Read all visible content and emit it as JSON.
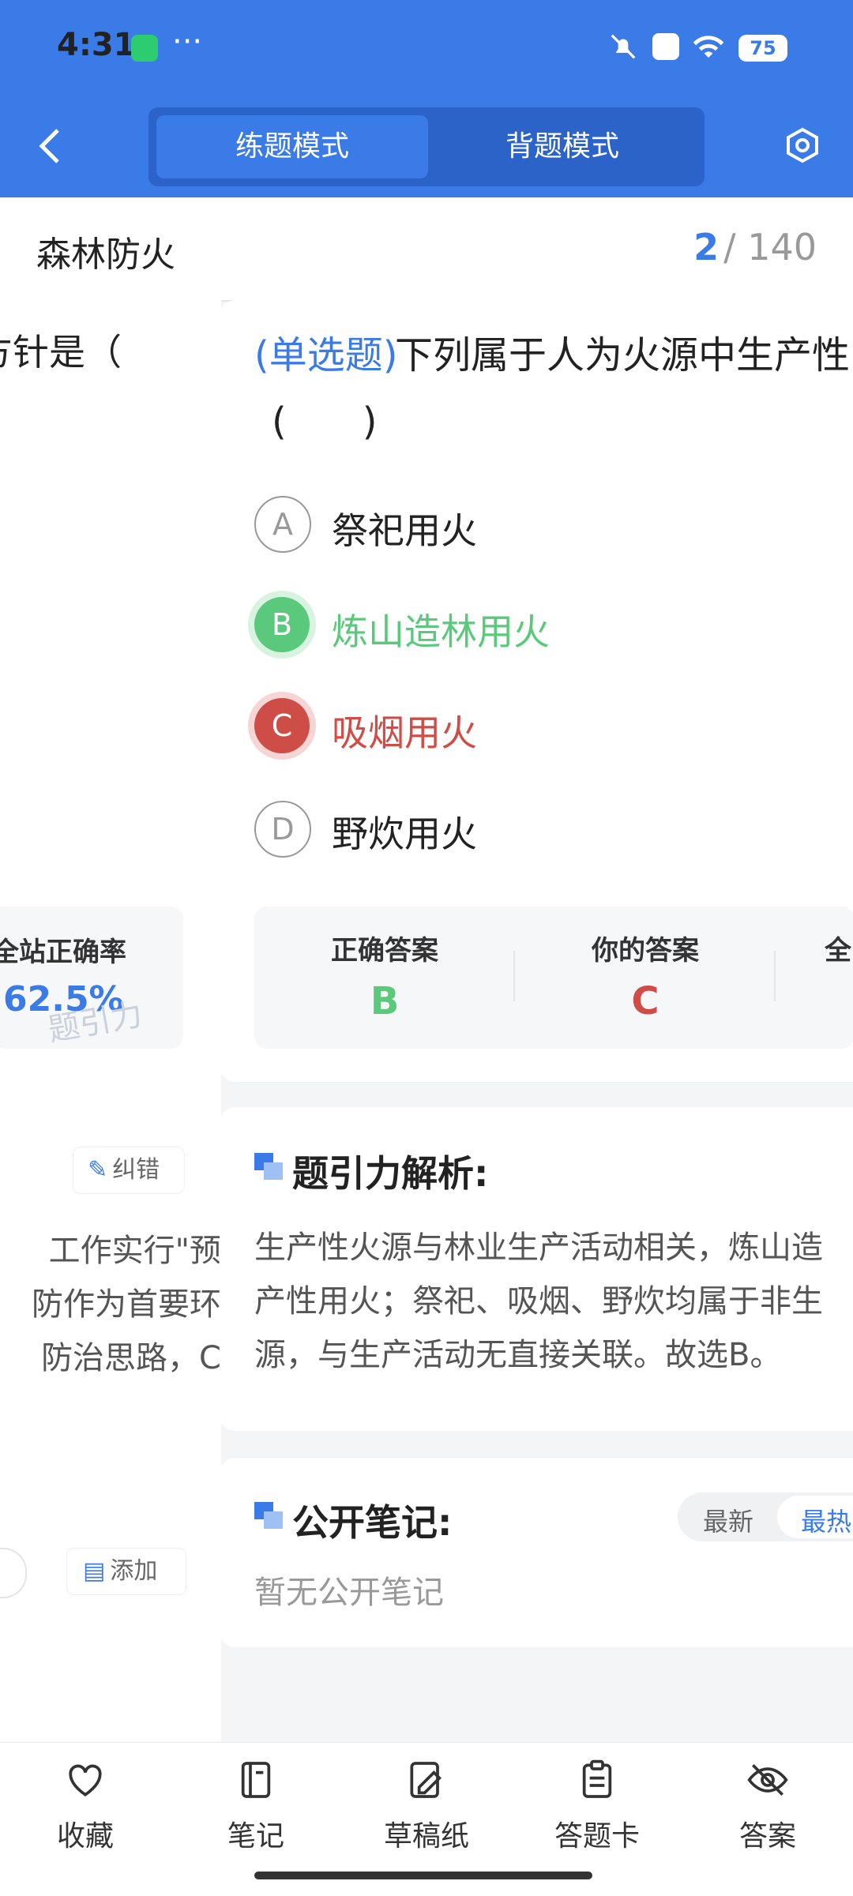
{
  "status_bar": {
    "time": "4:31",
    "more": "···",
    "battery": "75"
  },
  "header": {
    "tabs": [
      "练题模式",
      "背题模式"
    ],
    "active_tab": 0
  },
  "section": {
    "title": "森林防火",
    "current": "2",
    "total": "/ 140"
  },
  "left_preview": {
    "question_fragment": "方针是（",
    "stat_label": "全站正确率",
    "stat_value": "62.5%",
    "watermark": "题引力",
    "correct_button": "纠错",
    "analysis_lines": [
      "工作实行\"预",
      "防作为首要环",
      "防治思路，C"
    ],
    "add_button": "添加"
  },
  "question": {
    "type": "(单选题)",
    "text": "下列属于人为火源中生产性",
    "blank": "(　　)",
    "options": [
      {
        "letter": "A",
        "text": "祭祀用火",
        "state": "plain"
      },
      {
        "letter": "B",
        "text": "炼山造林用火",
        "state": "right"
      },
      {
        "letter": "C",
        "text": "吸烟用火",
        "state": "wrong"
      },
      {
        "letter": "D",
        "text": "野炊用火",
        "state": "plain"
      }
    ]
  },
  "answer": {
    "correct_label": "正确答案",
    "correct_value": "B",
    "yours_label": "你的答案",
    "yours_value": "C",
    "third_label": "全"
  },
  "analysis": {
    "heading": "题引力解析:",
    "lines": [
      "生产性火源与林业生产活动相关，炼山造",
      "产性用火；祭祀、吸烟、野炊均属于非生",
      "源，与生产活动无直接关联。故选B。"
    ]
  },
  "notes": {
    "heading": "公开笔记:",
    "sort_new": "最新",
    "sort_hot": "最热",
    "empty": "暂无公开笔记"
  },
  "bottom_nav": [
    {
      "label": "收藏",
      "icon": "heart-icon"
    },
    {
      "label": "笔记",
      "icon": "notebook-icon"
    },
    {
      "label": "草稿纸",
      "icon": "draft-icon"
    },
    {
      "label": "答题卡",
      "icon": "answer-sheet-icon"
    },
    {
      "label": "答案",
      "icon": "eye-off-icon"
    }
  ],
  "colors": {
    "primary": "#3b7be7",
    "correct": "#5bc97c",
    "wrong": "#cf4d47"
  }
}
